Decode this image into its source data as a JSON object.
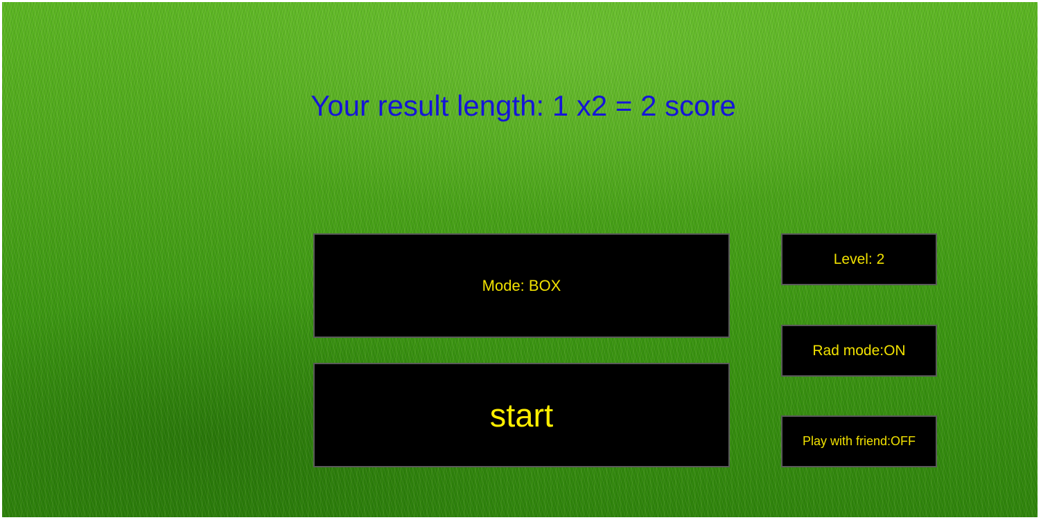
{
  "result": {
    "text": "Your result length: 1 x2 = 2 score"
  },
  "buttons": {
    "mode": "Mode: BOX",
    "start": "start",
    "level": "Level: 2",
    "rad_mode": "Rad mode:ON",
    "play_with_friend": "Play with friend:OFF"
  },
  "colors": {
    "result_text": "#1515d8",
    "button_text": "#f2e200",
    "button_background": "#000000",
    "background": "grass-green"
  }
}
